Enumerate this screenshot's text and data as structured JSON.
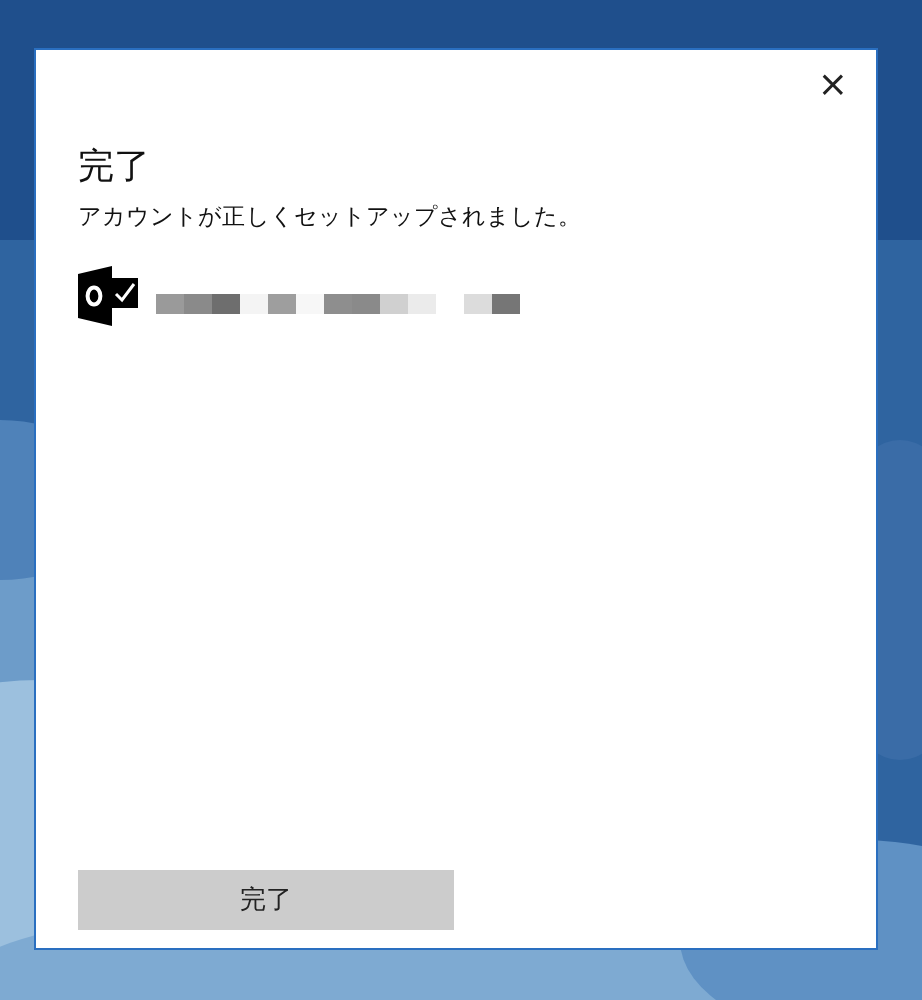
{
  "dialog": {
    "close": "×",
    "title": "完了",
    "message": "アカウントが正しくセットアップされました。",
    "button": "完了"
  }
}
